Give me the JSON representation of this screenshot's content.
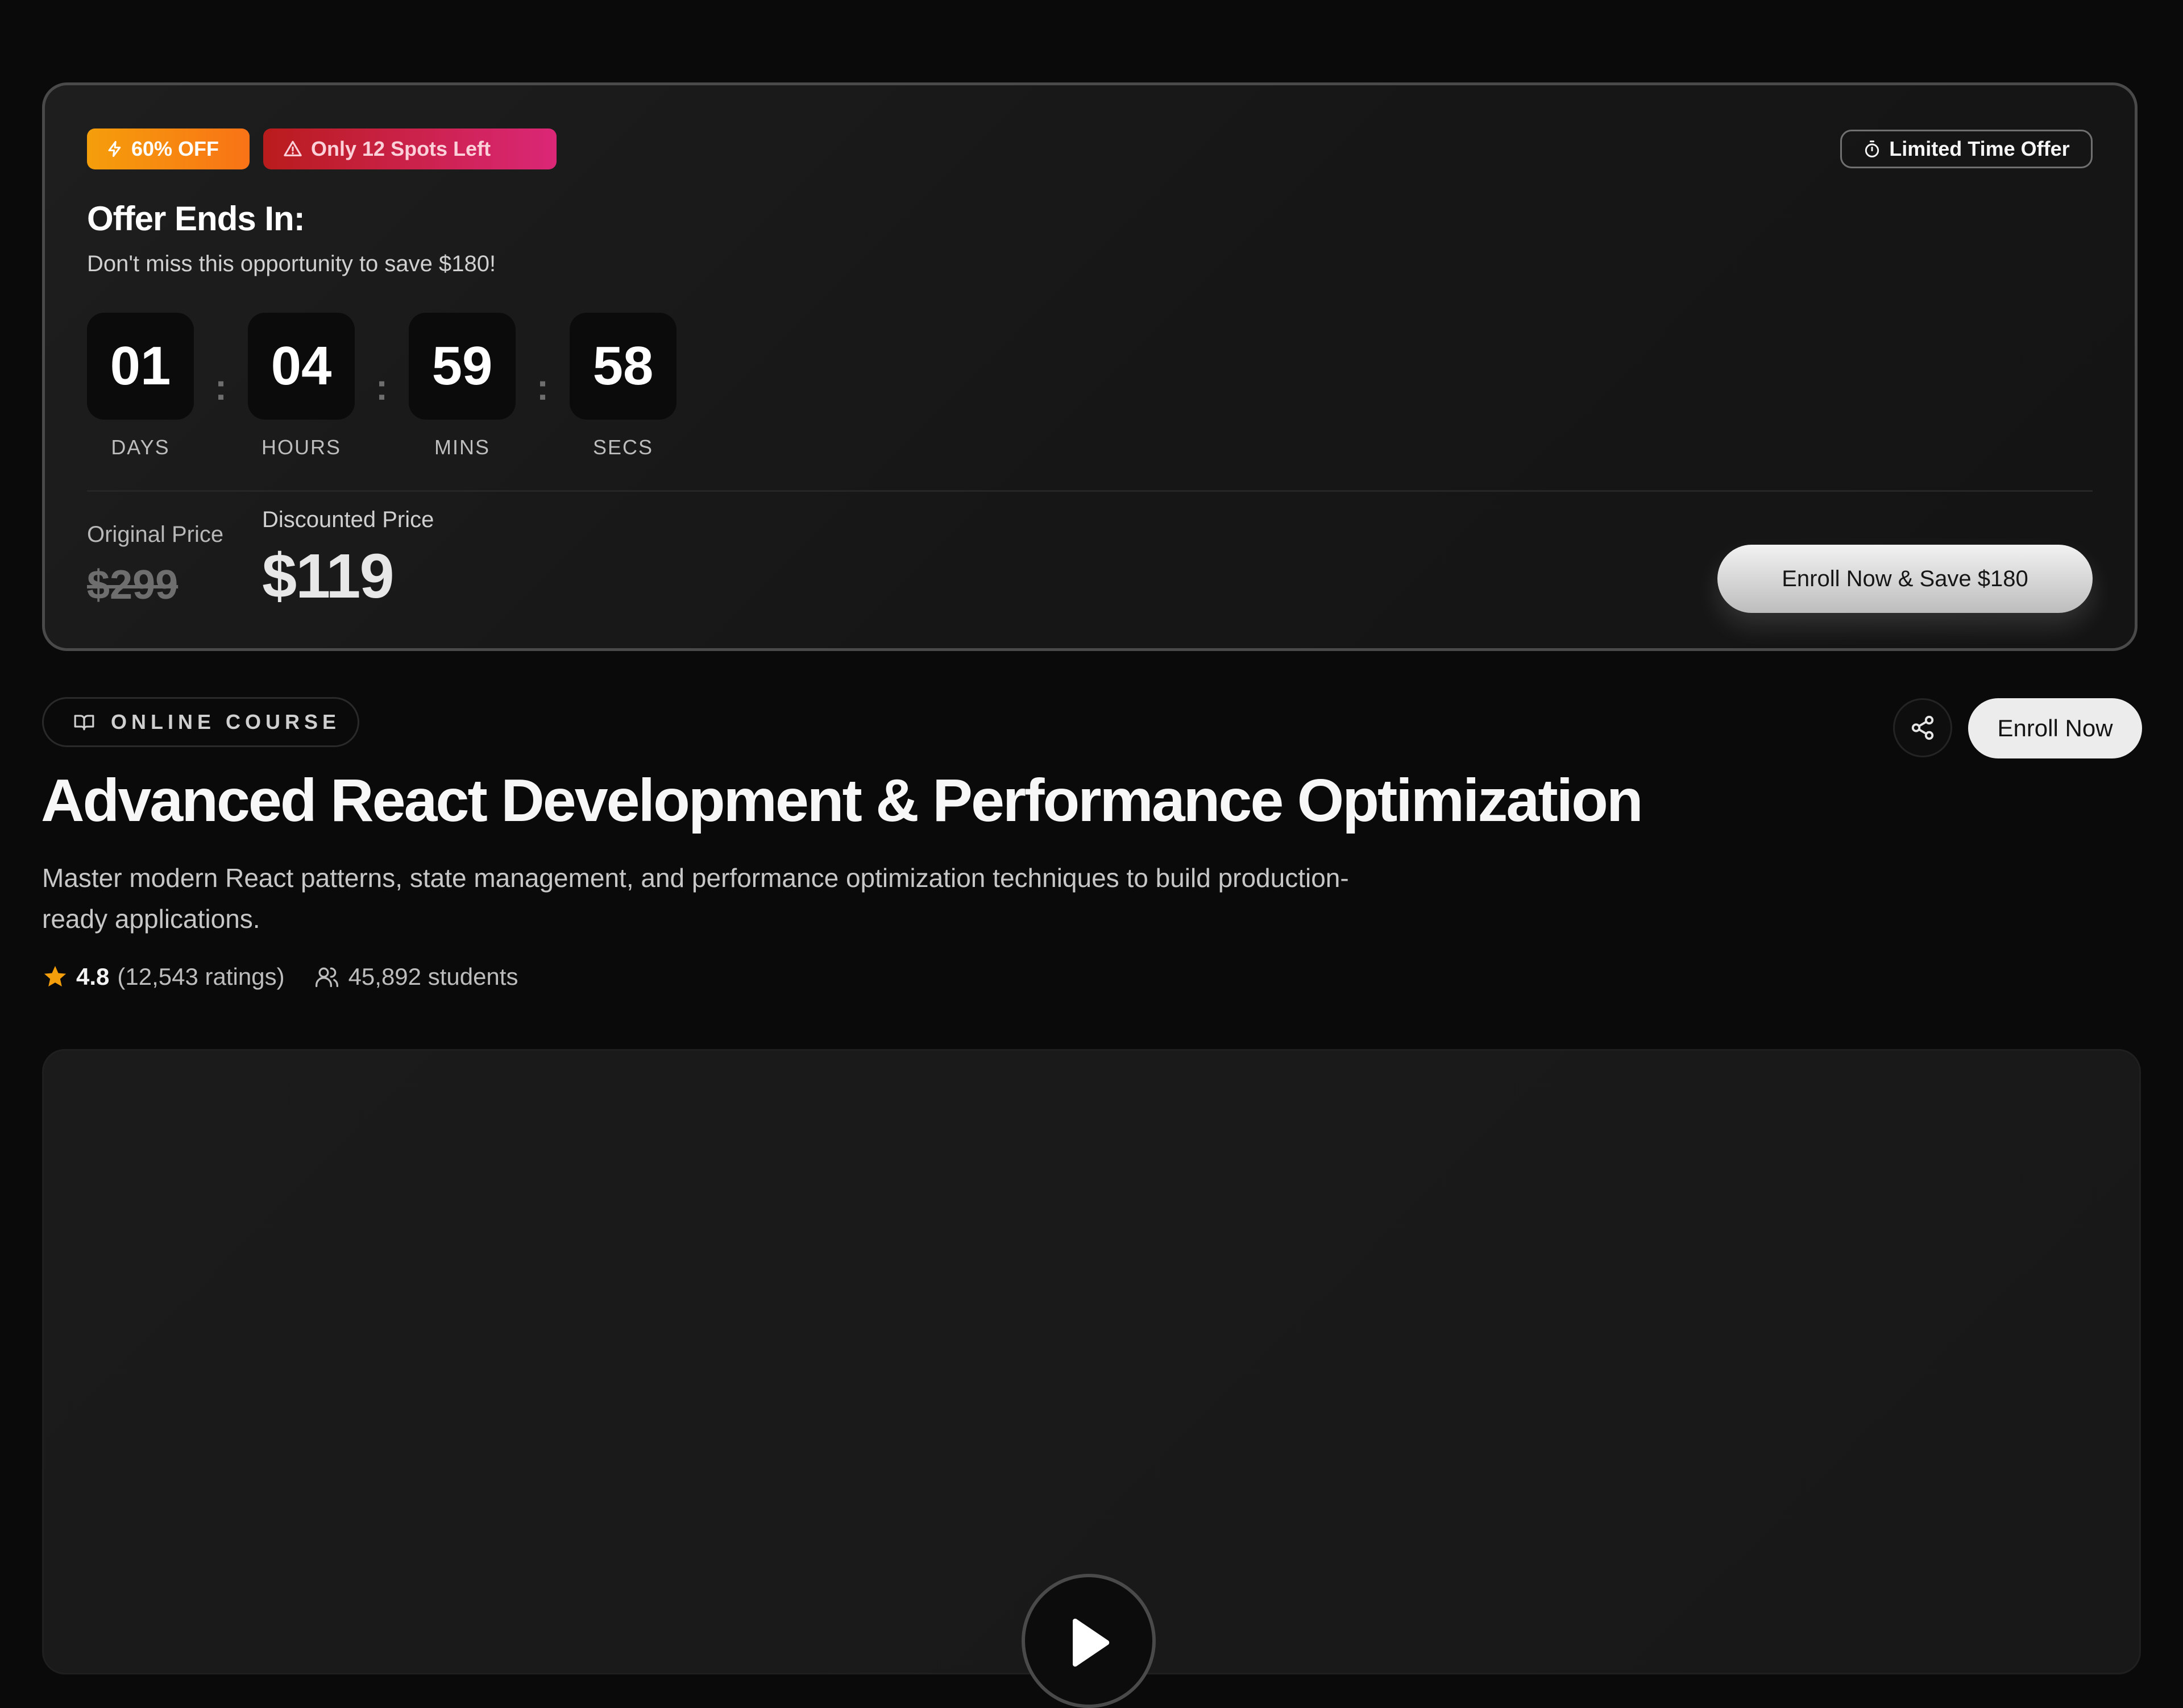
{
  "offer": {
    "discount_badge": "60% OFF",
    "spots_badge": "Only 12 Spots Left",
    "limited_badge": "Limited Time Offer",
    "title": "Offer Ends In:",
    "subtitle": "Don't miss this opportunity to save $180!",
    "countdown": [
      {
        "value": "01",
        "label": "DAYS"
      },
      {
        "value": "04",
        "label": "HOURS"
      },
      {
        "value": "59",
        "label": "MINS"
      },
      {
        "value": "58",
        "label": "SECS"
      }
    ],
    "separator": ":",
    "original_price_label": "Original Price",
    "original_price": "$299",
    "discounted_price_label": "Discounted Price",
    "discounted_price": "$119",
    "cta_label": "Enroll Now & Save $180"
  },
  "course": {
    "category": "ONLINE COURSE",
    "title": "Advanced React Development & Performance Optimization",
    "description": "Master modern React patterns, state management, and performance optimization techniques to build production-ready applications.",
    "rating": "4.8",
    "rating_count": "(12,543 ratings)",
    "students": "45,892 students",
    "enroll_label": "Enroll Now"
  },
  "icons": {
    "discount": "zap-icon",
    "spots": "alert-triangle-icon",
    "limited": "timer-icon",
    "category": "book-open-icon",
    "share": "share-icon",
    "rating": "star-icon",
    "students": "users-icon",
    "video": "play-icon"
  },
  "colors": {
    "accent_orange": "#f97316",
    "accent_red": "#db2777",
    "star": "#f59e0b",
    "background": "#0a0a0a"
  }
}
